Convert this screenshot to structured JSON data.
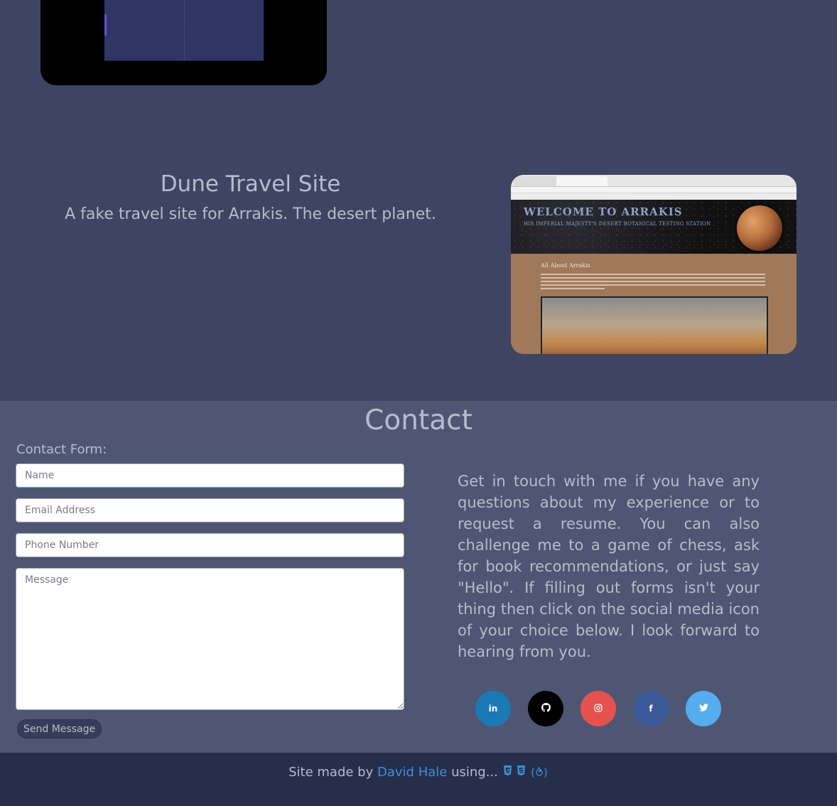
{
  "project": {
    "title": "Dune Travel Site",
    "description": "A fake travel site for Arrakis. The desert planet.",
    "screenshot": {
      "header_title": "WELCOME TO ARRAKIS",
      "header_subtitle": "HIS IMPERIAL MAJESTY'S DESERT BOTANICAL TESTING STATION",
      "section_title": "All About Arrakis"
    }
  },
  "contact": {
    "heading": "Contact",
    "form_label": "Contact Form:",
    "name_placeholder": "Name",
    "email_placeholder": "Email Address",
    "phone_placeholder": "Phone Number",
    "message_placeholder": "Message",
    "send_label": "Send Message",
    "text": "Get in touch with me if you have any questions about my experience or to request a resume. You can also challenge me to a game of chess, ask for book recommendations, or just say \"Hello\". If filling out forms isn't your thing then click on the social media icon of your choice below. I look forward to hearing from you.",
    "socials": [
      {
        "name": "linkedin-icon",
        "glyph": "in",
        "color": "#1a7ab5"
      },
      {
        "name": "github-icon",
        "glyph": "⬤",
        "color": "#000000"
      },
      {
        "name": "instagram-icon",
        "glyph": "◎",
        "color": "#e5524e"
      },
      {
        "name": "facebook-icon",
        "glyph": "f",
        "color": "#3b5998"
      },
      {
        "name": "twitter-icon",
        "glyph": "✦",
        "color": "#55acee"
      }
    ]
  },
  "footer": {
    "prefix": "Site made by",
    "author": "David Hale",
    "suffix": "using...",
    "tech_icons": [
      "html5-icon",
      "css3-icon",
      "react-icon"
    ]
  }
}
